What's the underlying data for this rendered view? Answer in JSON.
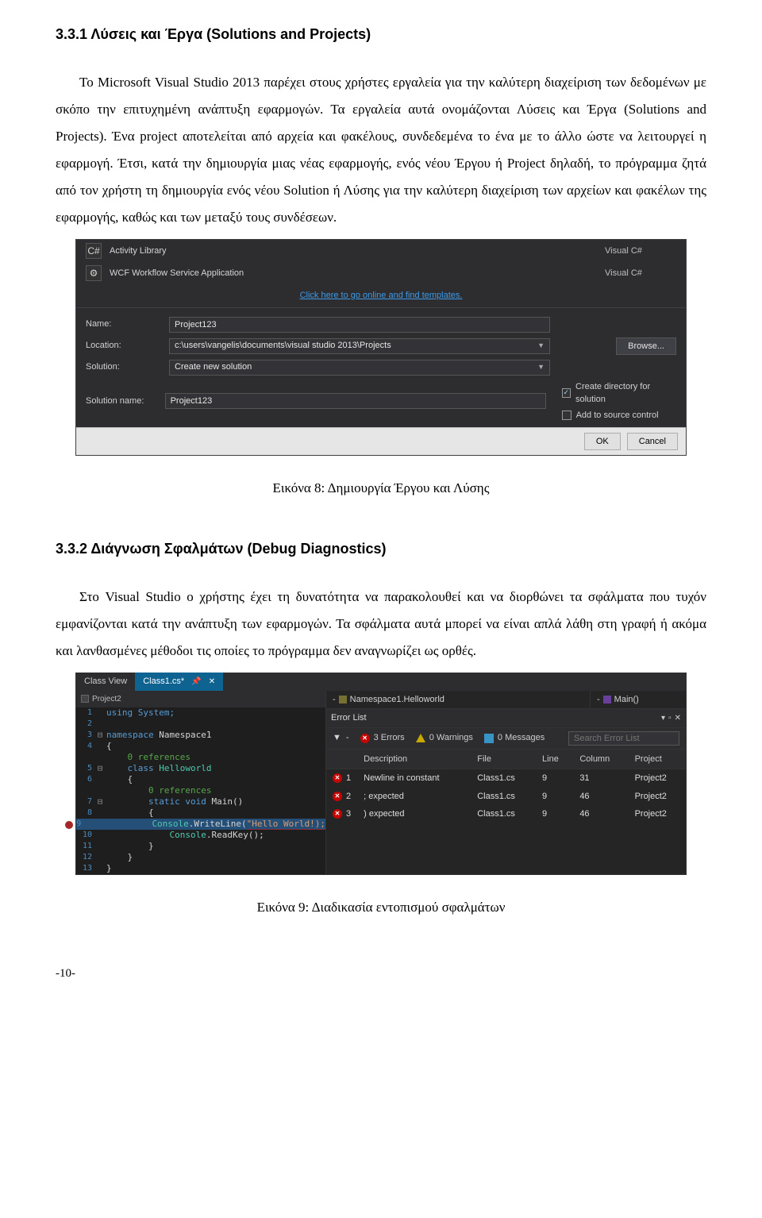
{
  "sec1": {
    "heading": "3.3.1  Λύσεις και Έργα (Solutions and Projects)",
    "para": "Το Microsoft Visual Studio 2013 παρέχει στους χρήστες εργαλεία για την καλύτερη διαχείριση των δεδομένων με σκόπο την επιτυχημένη ανάπτυξη εφαρμογών. Τα εργαλεία αυτά ονομάζονται Λύσεις και Έργα (Solutions and Projects). Ένα project αποτελείται από αρχεία και φακέλους, συνδεδεμένα το ένα με το άλλο ώστε να λειτουργεί η εφαρμογή. Έτσι, κατά την δημιουργία μιας νέας εφαρμογής, ενός νέου Έργου ή Project δηλαδή, το πρόγραμμα ζητά από τον χρήστη τη δημιουργία ενός νέου Solution ή Λύσης για την καλύτερη διαχείριση των αρχείων και φακέλων της εφαρμογής, καθώς και των μεταξύ τους συνδέσεων."
  },
  "dialog": {
    "tpl_activity": "Activity Library",
    "tpl_wcf": "WCF Workflow Service Application",
    "lang": "Visual C#",
    "link": "Click here to go online and find templates.",
    "lbl_name": "Name:",
    "lbl_location": "Location:",
    "lbl_solution": "Solution:",
    "lbl_solname": "Solution name:",
    "val_name": "Project123",
    "val_location": "c:\\users\\vangelis\\documents\\visual studio 2013\\Projects",
    "val_solution": "Create new solution",
    "val_solname": "Project123",
    "browse": "Browse...",
    "chk_dir": "Create directory for solution",
    "chk_src": "Add to source control",
    "ok": "OK",
    "cancel": "Cancel"
  },
  "caption1": "Εικόνα 8: Δημιουργία Έργου και Λύσης",
  "sec2": {
    "heading": "3.3.2   Διάγνωση Σφαλμάτων (Debug Diagnostics)",
    "para": "Στο Visual Studio ο χρήστης έχει τη δυνατότητα να παρακολουθεί και να διορθώνει τα σφάλματα που τυχόν εμφανίζονται κατά την ανάπτυξη των εφαρμογών. Τα σφάλματα αυτά μπορεί να είναι απλά λάθη στη γραφή ή ακόμα και λανθασμένες μέθοδοι τις οποίες το πρόγραμμα δεν αναγνωρίζει ως ορθές."
  },
  "ide": {
    "tab_classview": "Class View",
    "tab_file": "Class1.cs*",
    "proj": "Project2",
    "crumb_ns": "Namespace1.Helloworld",
    "crumb_main": "Main()",
    "code": {
      "l1": "using System;",
      "l3a": "namespace ",
      "l3b": "Namespace1",
      "l4": "{",
      "ref0": "0 references",
      "l5a": "class ",
      "l5b": "Helloworld",
      "l6": "{",
      "l7a": "static void ",
      "l7b": "Main()",
      "l8": "{",
      "l9a": "Console",
      "l9b": ".WriteLine(",
      "l9c": "\"Hello World!);",
      "l10a": "Console",
      "l10b": ".ReadKey();",
      "l11": "}",
      "l12": "}",
      "l13": "}"
    },
    "errlist": {
      "title": "Error List",
      "errcount": "3 Errors",
      "warncount": "0 Warnings",
      "msgcount": "0 Messages",
      "search_ph": "Search Error List",
      "col_desc": "Description",
      "col_file": "File",
      "col_line": "Line",
      "col_col": "Column",
      "col_proj": "Project",
      "rows": [
        {
          "n": "1",
          "desc": "Newline in constant",
          "file": "Class1.cs",
          "line": "9",
          "col": "31",
          "proj": "Project2"
        },
        {
          "n": "2",
          "desc": "; expected",
          "file": "Class1.cs",
          "line": "9",
          "col": "46",
          "proj": "Project2"
        },
        {
          "n": "3",
          "desc": ") expected",
          "file": "Class1.cs",
          "line": "9",
          "col": "46",
          "proj": "Project2"
        }
      ]
    }
  },
  "caption2": "Εικόνα 9: Διαδικασία εντοπισμού σφαλμάτων",
  "page": "-10-"
}
